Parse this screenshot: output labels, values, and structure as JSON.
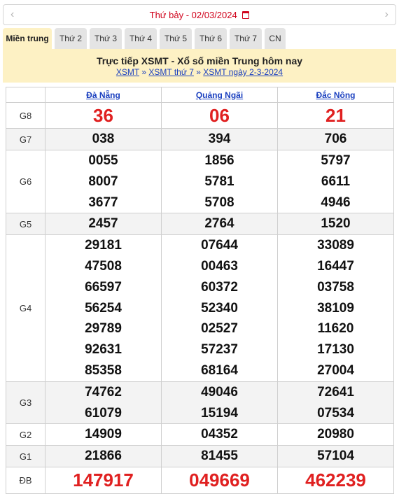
{
  "date_nav": {
    "prev_icon": "chevron-left-icon",
    "weekday": "Thứ bảy -",
    "date": "02/03/2024",
    "next_icon": "chevron-right-icon"
  },
  "tabs": [
    "Miền trung",
    "Thứ 2",
    "Thứ 3",
    "Thứ 4",
    "Thứ 5",
    "Thứ 6",
    "Thứ 7",
    "CN"
  ],
  "header": {
    "title": "Trực tiếp XSMT - Xổ số miền Trung hôm nay",
    "breadcrumb": [
      "XSMT",
      "XSMT thứ 7",
      "XSMT ngày 2-3-2024"
    ],
    "separator": "»"
  },
  "provinces": [
    "Đà Nẵng",
    "Quảng Ngãi",
    "Đắc Nông"
  ],
  "results": [
    {
      "label": "G8",
      "values": [
        [
          "36"
        ],
        [
          "06"
        ],
        [
          "21"
        ]
      ]
    },
    {
      "label": "G7",
      "values": [
        [
          "038"
        ],
        [
          "394"
        ],
        [
          "706"
        ]
      ]
    },
    {
      "label": "G6",
      "values": [
        [
          "0055",
          "8007",
          "3677"
        ],
        [
          "1856",
          "5781",
          "5708"
        ],
        [
          "5797",
          "6611",
          "4946"
        ]
      ]
    },
    {
      "label": "G5",
      "values": [
        [
          "2457"
        ],
        [
          "2764"
        ],
        [
          "1520"
        ]
      ]
    },
    {
      "label": "G4",
      "values": [
        [
          "29181",
          "47508",
          "66597",
          "56254",
          "29789",
          "92631",
          "85358"
        ],
        [
          "07644",
          "00463",
          "60372",
          "52340",
          "02527",
          "57237",
          "68164"
        ],
        [
          "33089",
          "16447",
          "03758",
          "38109",
          "11620",
          "17130",
          "27004"
        ]
      ]
    },
    {
      "label": "G3",
      "values": [
        [
          "74762",
          "61079"
        ],
        [
          "49046",
          "15194"
        ],
        [
          "72641",
          "07534"
        ]
      ]
    },
    {
      "label": "G2",
      "values": [
        [
          "14909"
        ],
        [
          "04352"
        ],
        [
          "20980"
        ]
      ]
    },
    {
      "label": "G1",
      "values": [
        [
          "21866"
        ],
        [
          "81455"
        ],
        [
          "57104"
        ]
      ]
    },
    {
      "label": "ĐB",
      "values": [
        [
          "147917"
        ],
        [
          "049669"
        ],
        [
          "462239"
        ]
      ]
    }
  ],
  "colors": {
    "accent_red": "#d0021b",
    "tab_active_bg": "#fdf1c4",
    "link_blue": "#1a3fbf"
  }
}
